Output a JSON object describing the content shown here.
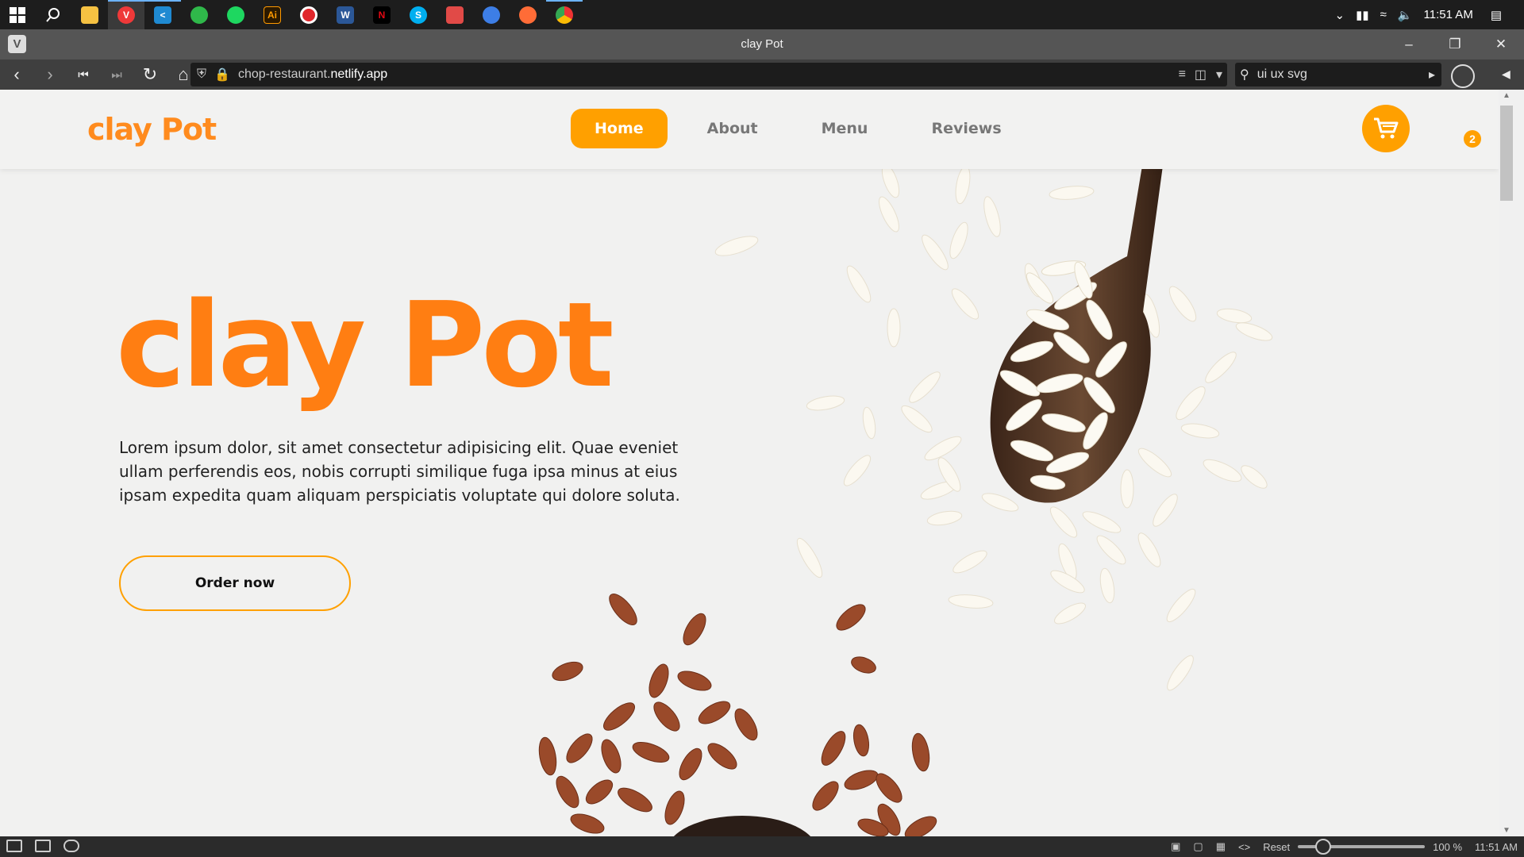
{
  "taskbar": {
    "apps": [
      "windows-start",
      "search",
      "file-explorer",
      "vivaldi",
      "vscode",
      "whatsapp",
      "spotify",
      "illustrator",
      "recorder",
      "word",
      "netflix",
      "skype",
      "mail",
      "google-photos",
      "postman",
      "chrome"
    ],
    "clock": "11:51 AM"
  },
  "window": {
    "title": "clay Pot"
  },
  "address_bar": {
    "url_prefix": "chop-restaurant.",
    "url_domain": "netlify.app",
    "search_value": "ui ux svg"
  },
  "site": {
    "brand": "clay Pot",
    "nav": [
      "Home",
      "About",
      "Menu",
      "Reviews"
    ],
    "active_nav": "Home",
    "cart_count": "2",
    "hero_title": "clay Pot",
    "hero_text": "Lorem ipsum dolor, sit amet consectetur adipisicing elit. Quae eveniet ullam perferendis eos, nobis corrupti similique fuga ipsa minus at eius ipsam expedita quam aliquam perspiciatis voluptate qui dolore soluta.",
    "cta": "Order now"
  },
  "status_bar": {
    "reset": "Reset",
    "zoom": "100 %",
    "clock": "11:51 AM"
  },
  "colors": {
    "accent": "#ffa000",
    "brand": "#ff8b1e",
    "page_bg": "#f1f1f0"
  }
}
